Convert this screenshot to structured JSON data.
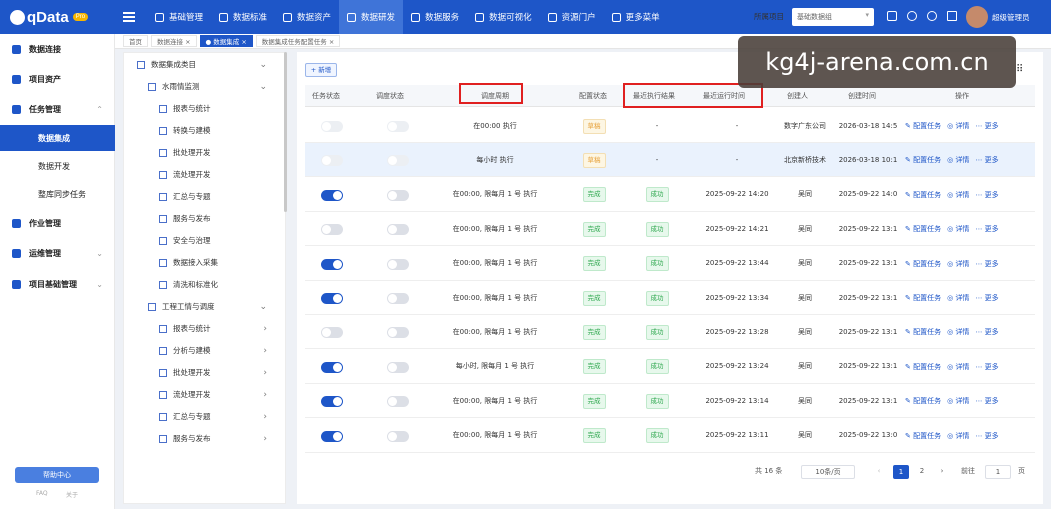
{
  "app": {
    "logo": "qData",
    "badge": "Pro"
  },
  "topnav": [
    {
      "label": "基础管理",
      "icon": "box-icon"
    },
    {
      "label": "数据标准",
      "icon": "book-icon"
    },
    {
      "label": "数据资产",
      "icon": "asset-icon"
    },
    {
      "label": "数据研发",
      "icon": "cube-icon",
      "active": true
    },
    {
      "label": "数据服务",
      "icon": "service-icon"
    },
    {
      "label": "数据可视化",
      "icon": "chart-icon"
    },
    {
      "label": "资源门户",
      "icon": "portal-icon"
    },
    {
      "label": "更多菜单",
      "icon": "more-icon"
    }
  ],
  "header": {
    "project_label": "所属项目",
    "project_value": "基础数据组",
    "username": "超级管理员"
  },
  "sidebar": {
    "items": [
      {
        "label": "数据连接"
      },
      {
        "label": "项目资产"
      },
      {
        "label": "任务管理"
      },
      {
        "label": "作业管理"
      },
      {
        "label": "运维管理"
      },
      {
        "label": "项目基础管理"
      }
    ],
    "subs": [
      {
        "label": "数据集成"
      },
      {
        "label": "数据开发"
      },
      {
        "label": "整库同步任务"
      }
    ],
    "help": "帮助中心",
    "faq": "FAQ",
    "about": "关于"
  },
  "tabs": [
    {
      "label": "首页"
    },
    {
      "label": "数据连接 ×"
    },
    {
      "label": "● 数据集成 ×"
    },
    {
      "label": "数据集成任务配置任务 ×"
    }
  ],
  "tree": {
    "root": "数据集成类目",
    "groups": [
      {
        "label": "水雨情监测",
        "children": [
          "报表与统计",
          "转换与建模",
          "批处理开发",
          "流处理开发",
          "汇总与专题",
          "服务与发布",
          "安全与治理",
          "数据接入采集",
          "清洗和标准化"
        ]
      },
      {
        "label": "工程工情与调度",
        "children": [
          "报表与统计",
          "分析与建模",
          "批处理开发",
          "流处理开发",
          "汇总与专题",
          "服务与发布"
        ]
      }
    ]
  },
  "toolbar": {
    "add": "+ 新增"
  },
  "table": {
    "headers": {
      "task_status": "任务状态",
      "schedule_status": "调度状态",
      "schedule_cycle": "调度周期",
      "config_status": "配置状态",
      "last_result": "最近执行结果",
      "last_run": "最近运行时间",
      "creator": "创建人",
      "created": "创建时间",
      "ops": "操作"
    },
    "rows": [
      {
        "task_on": false,
        "sched_on": false,
        "cycle": "在00:00 执行",
        "config": "草稿",
        "result": "-",
        "last_run": "-",
        "creator": "数字广东公司",
        "created": "2026-03-18 14:5"
      },
      {
        "task_on": false,
        "sched_on": false,
        "cycle": "每小时 执行",
        "config": "草稿",
        "result": "-",
        "last_run": "-",
        "creator": "北京新桥技术",
        "created": "2026-03-18 10:1",
        "selected": true
      },
      {
        "task_on": true,
        "sched_on": false,
        "cycle": "在00:00, 限每月 1 号 执行",
        "config": "完成",
        "result": "成功",
        "last_run": "2025-09-22 14:20",
        "creator": "吴同",
        "created": "2025-09-22 14:0"
      },
      {
        "task_on": false,
        "sched_on": false,
        "cycle": "在00:00, 限每月 1 号 执行",
        "config": "完成",
        "result": "成功",
        "last_run": "2025-09-22 14:21",
        "creator": "吴同",
        "created": "2025-09-22 13:1"
      },
      {
        "task_on": true,
        "sched_on": false,
        "cycle": "在00:00, 限每月 1 号 执行",
        "config": "完成",
        "result": "成功",
        "last_run": "2025-09-22 13:44",
        "creator": "吴同",
        "created": "2025-09-22 13:1"
      },
      {
        "task_on": true,
        "sched_on": false,
        "cycle": "在00:00, 限每月 1 号 执行",
        "config": "完成",
        "result": "成功",
        "last_run": "2025-09-22 13:34",
        "creator": "吴同",
        "created": "2025-09-22 13:1"
      },
      {
        "task_on": false,
        "sched_on": false,
        "cycle": "在00:00, 限每月 1 号 执行",
        "config": "完成",
        "result": "成功",
        "last_run": "2025-09-22 13:28",
        "creator": "吴同",
        "created": "2025-09-22 13:1"
      },
      {
        "task_on": true,
        "sched_on": false,
        "cycle": "每小时, 限每月 1 号 执行",
        "config": "完成",
        "result": "成功",
        "last_run": "2025-09-22 13:24",
        "creator": "吴同",
        "created": "2025-09-22 13:1"
      },
      {
        "task_on": true,
        "sched_on": false,
        "cycle": "在00:00, 限每月 1 号 执行",
        "config": "完成",
        "result": "成功",
        "last_run": "2025-09-22 13:14",
        "creator": "吴同",
        "created": "2025-09-22 13:1"
      },
      {
        "task_on": true,
        "sched_on": false,
        "cycle": "在00:00, 限每月 1 号 执行",
        "config": "完成",
        "result": "成功",
        "last_run": "2025-09-22 13:11",
        "creator": "吴同",
        "created": "2025-09-22 13:0"
      }
    ],
    "actions": {
      "config": "配置任务",
      "detail": "详情",
      "more": "更多"
    }
  },
  "pager": {
    "total": "共 16 条",
    "size": "10条/页",
    "pages": [
      "1",
      "2"
    ],
    "goto": "前往",
    "goto_value": "1",
    "page_unit": "页"
  },
  "watermark": "kg4j-arena.com.cn"
}
